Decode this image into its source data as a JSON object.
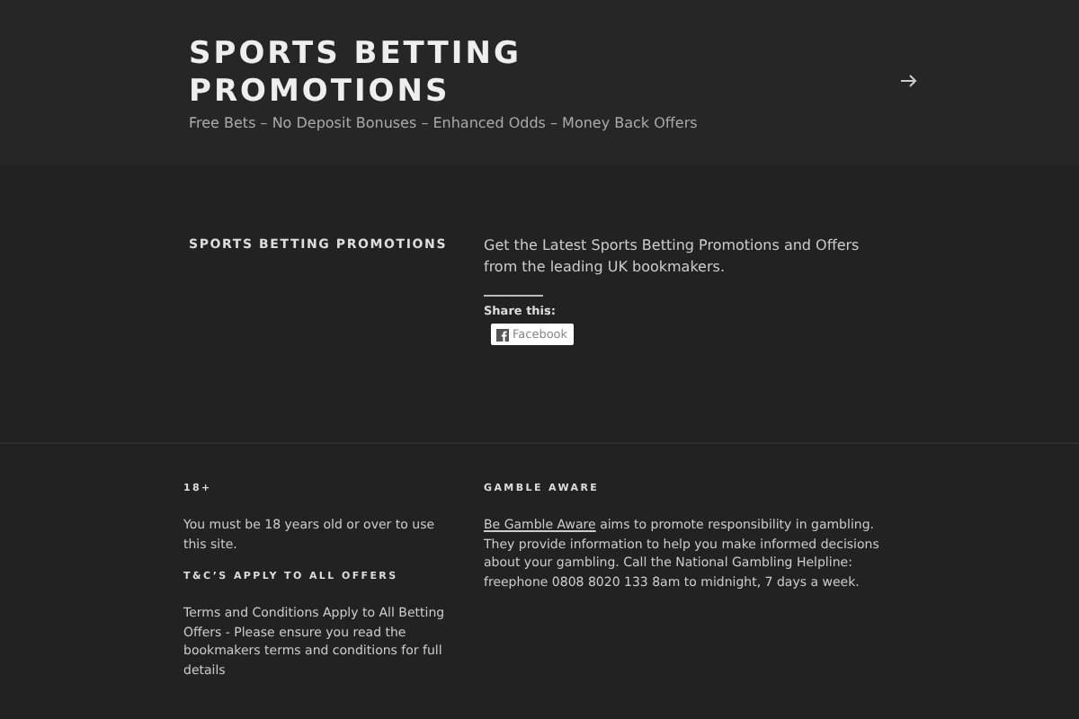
{
  "site": {
    "title": "SPORTS BETTING PROMOTIONS",
    "tagline": "Free Bets – No Deposit Bonuses – Enhanced Odds – Money Back Offers"
  },
  "page": {
    "heading": "SPORTS BETTING PROMOTIONS",
    "intro": "Get the Latest Sports Betting Promotions and Offers from the leading UK bookmakers.",
    "share_label": "Share this:",
    "share_buttons": [
      "Facebook"
    ]
  },
  "footer": {
    "columns": [
      {
        "widgets": [
          {
            "title": "18+",
            "text": "You must be 18 years old or over to use this site."
          },
          {
            "title": "T&C’S APPLY TO ALL OFFERS",
            "text": "Terms and Conditions Apply to All Betting Offers - Please ensure you read the bookmakers terms and conditions for full details"
          }
        ]
      },
      {
        "widgets": [
          {
            "title": "GAMBLE AWARE",
            "link": "Be Gamble Aware",
            "text": " aims to promote responsibility in gambling. They provide information to help you make informed decisions about your gambling. Call the National Gambling Helpline: freephone 0808 8020 133 8am to midnight, 7 days a week."
          }
        ]
      }
    ]
  }
}
